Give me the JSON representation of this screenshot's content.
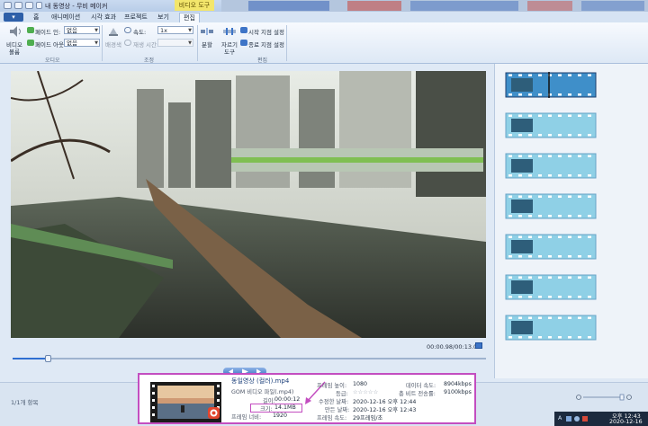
{
  "window": {
    "title": "내 동영상 - 무비 메이커",
    "context_tab_title": "비디오 도구"
  },
  "tabs": {
    "file": "▾",
    "items": [
      "홈",
      "애니메이션",
      "시각 효과",
      "프로젝트",
      "보기",
      "편집"
    ],
    "active": "편집"
  },
  "ribbon": {
    "audio": {
      "video_volume": "비디오\n볼륨",
      "video_volume_line1": "비디오",
      "video_volume_line2": "볼륨",
      "fade_in_label": "페이드 인:",
      "fade_in_value": "없음",
      "fade_out_label": "페이드 아웃:",
      "fade_out_value": "없음",
      "group": "오디오"
    },
    "adjust": {
      "background_color": "배경색",
      "speed_label": "속도:",
      "speed_value": "1x",
      "duration_label": "재생 시간:",
      "group": "조정"
    },
    "edit": {
      "split": "분할",
      "trim_tool_line1": "자르기",
      "trim_tool_line2": "도구",
      "set_start": "시작 지점 설정",
      "set_end": "종료 지점 설정",
      "group": "편집"
    }
  },
  "preview": {
    "timecode": "00:00.98/00:13.02",
    "progress_fraction": 0.075
  },
  "storyboard": {
    "clip_count": 7,
    "selected_index": 0
  },
  "status": {
    "item_count": "1/1개 항목"
  },
  "file_info": {
    "title": "동일영상 (컬러).mp4",
    "type": "GOM 비디오 파일(.mp4)",
    "length_label": "길이:",
    "length_value": "00:00:12",
    "size_label": "크기:",
    "size_value": "14.1MB",
    "frame_width_label": "프레임 너비:",
    "frame_width_value": "1920",
    "frame_height_label": "프레임 높이:",
    "frame_height_value": "1080",
    "rating_label": "등급:",
    "rating_value": "☆☆☆☆☆",
    "modified_label": "수정한 날짜:",
    "modified_value": "2020-12-16 오후 12:44",
    "created_label": "만든 날짜:",
    "created_value": "2020-12-16 오후 12:43",
    "frame_rate_label": "프레임 속도:",
    "frame_rate_value": "29프레임/초",
    "data_rate_label": "데이터 속도:",
    "data_rate_value": "8904kbps",
    "total_bitrate_label": "총 비트 전송률:",
    "total_bitrate_value": "9100kbps"
  },
  "taskbar": {
    "time": "오후 12:43",
    "date": "2020-12-16",
    "lang": "A"
  },
  "colors": {
    "accent": "#c34ec0",
    "ribbon_blue": "#2d5fa8",
    "context_yellow": "#f3e66b"
  }
}
